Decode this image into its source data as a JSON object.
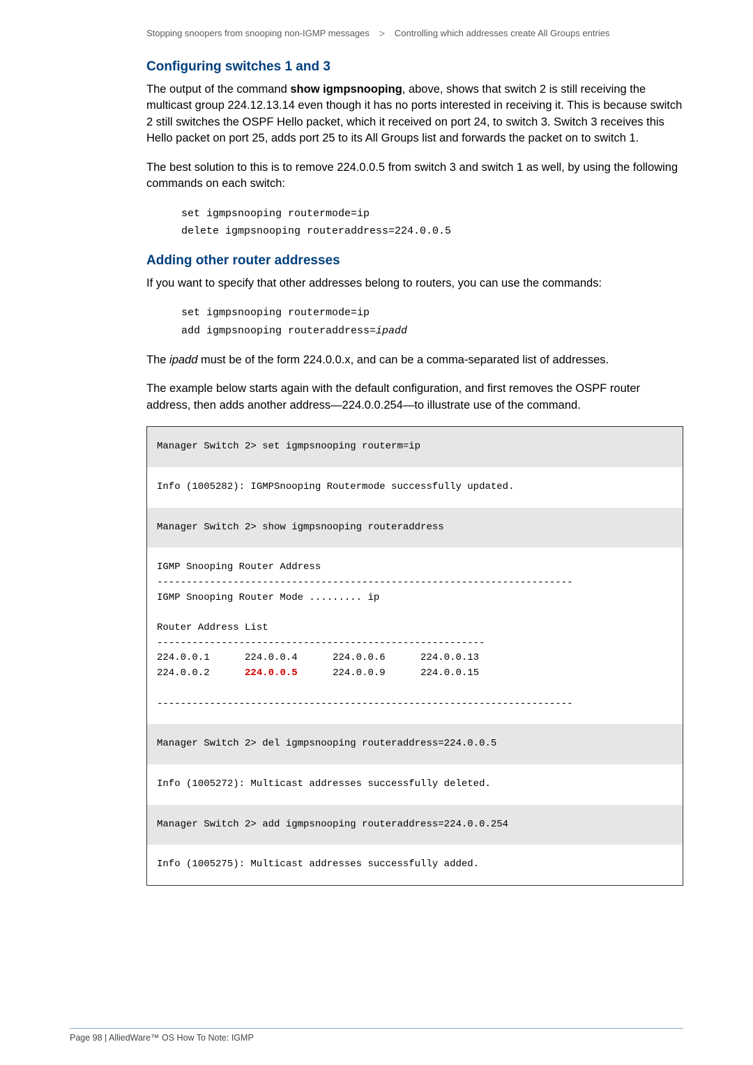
{
  "breadcrumb": {
    "part1": "Stopping snoopers from snooping non-IGMP messages",
    "sep": ">",
    "part2": "Controlling which addresses create All Groups entries"
  },
  "section1": {
    "heading": "Configuring switches 1 and 3",
    "p1a": "The output of the command ",
    "p1bold": "show igmpsnooping",
    "p1b": ", above, shows that switch 2 is still receiving the multicast group 224.12.13.14 even though it has no ports interested in receiving it. This is because switch 2 still switches the OSPF Hello packet, which it received on port 24, to switch 3. Switch 3 receives this Hello packet on port 25, adds port 25 to its All Groups list and forwards the packet on to switch 1.",
    "p2": "The best solution to this is to remove 224.0.0.5 from switch 3 and switch 1 as well, by using the following commands on each switch:",
    "code1": "set igmpsnooping routermode=ip",
    "code2": "delete igmpsnooping routeraddress=224.0.0.5"
  },
  "section2": {
    "heading": "Adding other router addresses",
    "p1": "If you want to specify that other addresses belong to routers, you can use the commands:",
    "code1": "set igmpsnooping routermode=ip",
    "code2a": "add igmpsnooping routeraddress=",
    "code2b": "ipadd",
    "p2a": "The ",
    "p2ital": "ipadd",
    "p2b": " must be of the form 224.0.0.x, and can be a comma-separated list of addresses.",
    "p3": "The example below starts again with the default configuration, and first removes the OSPF router address, then adds another address—224.0.0.254—to illustrate use of the command."
  },
  "terminal": {
    "l1": "Manager Switch 2> set igmpsnooping routerm=ip",
    "l2": "Info (1005282): IGMPSnooping Routermode successfully updated.",
    "l3": "Manager Switch 2> show igmpsnooping routeraddress",
    "block": "IGMP Snooping Router Address\n-----------------------------------------------------------------------\nIGMP Snooping Router Mode ......... ip\n\nRouter Address List\n--------------------------------------------------------\n224.0.0.1      224.0.0.4      224.0.0.6      224.0.0.13\n224.0.0.2      ",
    "block_hl": "224.0.0.5",
    "block_after": "      224.0.0.9      224.0.0.15\n\n-----------------------------------------------------------------------",
    "l4": "Manager Switch 2> del igmpsnooping routeraddress=224.0.0.5",
    "l5": "Info (1005272): Multicast addresses successfully deleted.",
    "l6": "Manager Switch 2> add igmpsnooping routeraddress=224.0.0.254",
    "l7": "Info (1005275): Multicast addresses successfully added."
  },
  "footer": "Page 98 | AlliedWare™ OS How To Note: IGMP"
}
